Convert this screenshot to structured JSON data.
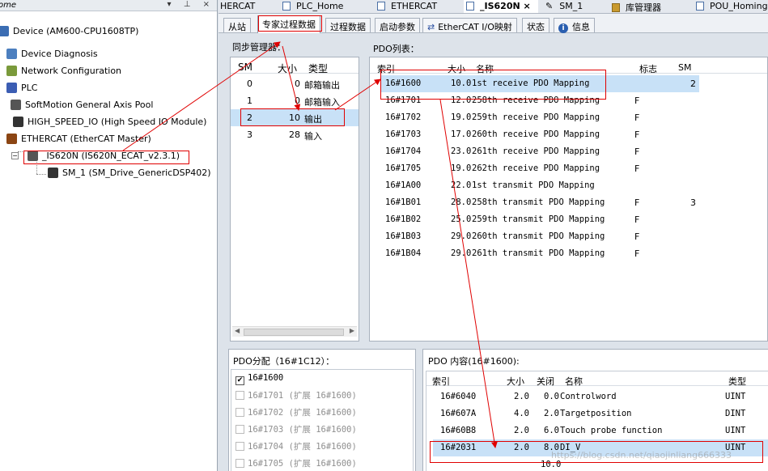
{
  "tree": {
    "header_title": "ome",
    "header_buttons": "▾ ⊥ ×",
    "items": [
      {
        "label": "Device (AM600-CPU1608TP)",
        "icon": "device-icon",
        "color": "#3b6db3"
      },
      {
        "label": "Device Diagnosis",
        "icon": "diagnosis-icon",
        "color": "#4c7fbf"
      },
      {
        "label": "Network Configuration",
        "icon": "network-config-icon",
        "color": "#7a9a3b"
      },
      {
        "label": "PLC",
        "icon": "plc-icon",
        "color": "#3b5db3"
      },
      {
        "label": "SoftMotion General Axis Pool",
        "icon": "axis-pool-icon",
        "color": "#555"
      },
      {
        "label": "HIGH_SPEED_IO (High Speed IO Module)",
        "icon": "io-module-icon",
        "color": "#333"
      },
      {
        "label": "ETHERCAT (EtherCAT Master)",
        "icon": "ethercat-master-icon",
        "color": "#8b4513"
      },
      {
        "label": "_IS620N (IS620N_ECAT_v2.3.1)",
        "icon": "servo-drive-icon",
        "color": "#555"
      },
      {
        "label": "SM_1 (SM_Drive_GenericDSP402)",
        "icon": "axis-icon",
        "color": "#333"
      }
    ]
  },
  "file_tabs": [
    {
      "label": "HERCAT"
    },
    {
      "label": "PLC_Home"
    },
    {
      "label": "ETHERCAT"
    },
    {
      "label": "_IS620N",
      "close": "×"
    },
    {
      "label": "SM_1"
    },
    {
      "label": "库管理器"
    },
    {
      "label": "POU_Homing"
    }
  ],
  "sub_tabs": [
    {
      "label": "从站"
    },
    {
      "label": "专家过程数据"
    },
    {
      "label": "过程数据"
    },
    {
      "label": "启动参数"
    },
    {
      "label": "EtherCAT I/O映射"
    },
    {
      "label": "状态"
    },
    {
      "label": "信息"
    }
  ],
  "sync_manager": {
    "title": "同步管理器：",
    "columns": [
      "SM",
      "大小",
      "类型"
    ],
    "rows": [
      {
        "sm": "0",
        "size": "0",
        "type": "邮箱输出"
      },
      {
        "sm": "1",
        "size": "0",
        "type": "邮箱输入"
      },
      {
        "sm": "2",
        "size": "10",
        "type": "输出"
      },
      {
        "sm": "3",
        "size": "28",
        "type": "输入"
      }
    ],
    "scroll_left": "◀",
    "scroll_right": "▶"
  },
  "pdo_list": {
    "title": "PDO列表：",
    "columns": [
      "索引",
      "大小",
      "名称",
      "标志",
      "SM"
    ],
    "rows": [
      {
        "index": "16#1600",
        "size": "10.0",
        "name": "1st receive PDO Mapping",
        "flag": "",
        "sm": "2"
      },
      {
        "index": "16#1701",
        "size": "12.0",
        "name": "258th receive PDO Mapping",
        "flag": "F",
        "sm": ""
      },
      {
        "index": "16#1702",
        "size": "19.0",
        "name": "259th receive PDO Mapping",
        "flag": "F",
        "sm": ""
      },
      {
        "index": "16#1703",
        "size": "17.0",
        "name": "260th receive PDO Mapping",
        "flag": "F",
        "sm": ""
      },
      {
        "index": "16#1704",
        "size": "23.0",
        "name": "261th receive PDO Mapping",
        "flag": "F",
        "sm": ""
      },
      {
        "index": "16#1705",
        "size": "19.0",
        "name": "262th receive PDO Mapping",
        "flag": "F",
        "sm": ""
      },
      {
        "index": "16#1A00",
        "size": "22.0",
        "name": "1st transmit PDO Mapping",
        "flag": "",
        "sm": ""
      },
      {
        "index": "16#1B01",
        "size": "28.0",
        "name": "258th transmit PDO Mapping",
        "flag": "F",
        "sm": "3"
      },
      {
        "index": "16#1B02",
        "size": "25.0",
        "name": "259th transmit PDO Mapping",
        "flag": "F",
        "sm": ""
      },
      {
        "index": "16#1B03",
        "size": "29.0",
        "name": "260th transmit PDO Mapping",
        "flag": "F",
        "sm": ""
      },
      {
        "index": "16#1B04",
        "size": "29.0",
        "name": "261th transmit PDO Mapping",
        "flag": "F",
        "sm": ""
      }
    ]
  },
  "pdo_assign": {
    "title": "PDO分配（16#1C12）：",
    "items": [
      {
        "label": "16#1600",
        "checked": true,
        "check_mark": "✔"
      },
      {
        "label": "16#1701 (扩展 16#1600)",
        "checked": false,
        "check_mark": ""
      },
      {
        "label": "16#1702 (扩展 16#1600)",
        "checked": false,
        "check_mark": ""
      },
      {
        "label": "16#1703 (扩展 16#1600)",
        "checked": false,
        "check_mark": ""
      },
      {
        "label": "16#1704 (扩展 16#1600)",
        "checked": false,
        "check_mark": ""
      },
      {
        "label": "16#1705 (扩展 16#1600)",
        "checked": false,
        "check_mark": ""
      }
    ]
  },
  "pdo_content": {
    "title": "PDO 内容(16#1600):",
    "columns": [
      "索引",
      "大小",
      "关闭",
      "名称",
      "类型"
    ],
    "rows": [
      {
        "index": "16#6040",
        "size": "2.0",
        "offset": "0.0",
        "name": "Controlword",
        "type": "UINT"
      },
      {
        "index": "16#607A",
        "size": "4.0",
        "offset": "2.0",
        "name": "Targetposition",
        "type": "DINT"
      },
      {
        "index": "16#60B8",
        "size": "2.0",
        "offset": "6.0",
        "name": "Touch probe function",
        "type": "UINT"
      },
      {
        "index": "16#2031",
        "size": "2.0",
        "offset": "8.0",
        "name": "DI_V",
        "type": "UINT"
      }
    ],
    "footer_value": "10.0",
    "watermark": "https://blog.csdn.net/qiaojinliang666333"
  },
  "colors": {
    "selection": "#c8e1f7",
    "annotation_red": "#e00000"
  }
}
